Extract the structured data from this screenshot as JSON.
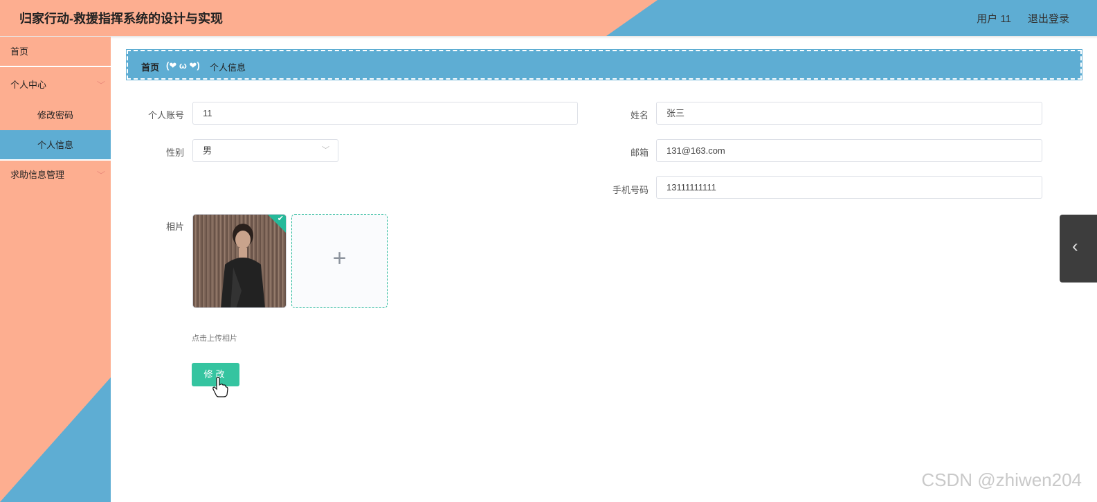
{
  "header": {
    "title": "归家行动-救援指挥系统的设计与实现",
    "user": "用户 11",
    "logout": "退出登录",
    "colors": {
      "left": "#fdae90",
      "right": "#5eadd3"
    }
  },
  "sidebar": {
    "items": [
      {
        "label": "首页"
      },
      {
        "label": "个人中心",
        "icon": "chevron-down-icon"
      },
      {
        "label": "修改密码"
      },
      {
        "label": "个人信息",
        "active": true
      },
      {
        "label": "求助信息管理",
        "icon": "chevron-down-icon"
      }
    ]
  },
  "breadcrumb": {
    "home": "首页",
    "separator": "(❤ ω ❤)",
    "current": "个人信息"
  },
  "form": {
    "account_label": "个人账号",
    "account_value": "11",
    "name_label": "姓名",
    "name_value": "张三",
    "gender_label": "性别",
    "gender_value": "男",
    "email_label": "邮箱",
    "email_value": "131@163.com",
    "phone_label": "手机号码",
    "phone_value": "13111111111",
    "photo_label": "相片",
    "upload_icon": "plus-icon",
    "upload_tip": "点击上传相片",
    "submit_label": "修改"
  },
  "accent_color": "#35c4a0",
  "watermark": "CSDN @zhiwen204"
}
